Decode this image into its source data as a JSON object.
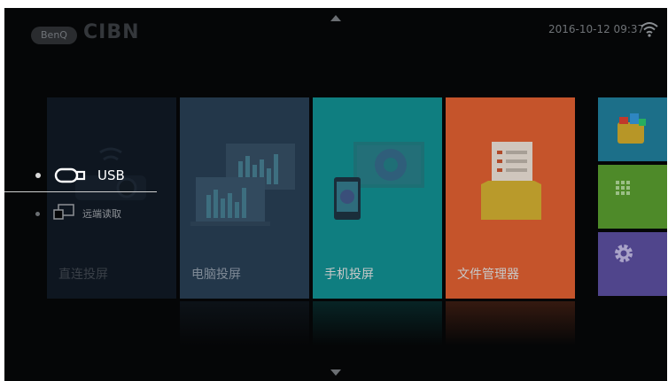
{
  "header": {
    "brand_logo": "BenQ",
    "partner_logo": "CIBN",
    "datetime": "2016-10-12 09:37",
    "wifi_icon": "wifi-icon",
    "nav_up_icon": "arrow-up-icon",
    "nav_down_icon": "arrow-down-icon"
  },
  "tiles": [
    {
      "label": "直连投屏",
      "color": "#0e1620"
    },
    {
      "label": "电脑投屏",
      "color": "#23374a"
    },
    {
      "label": "手机投屏",
      "color": "#0f7e80"
    },
    {
      "label": "文件管理器",
      "color": "#c5542b"
    }
  ],
  "side_tiles": [
    {
      "icon": "app-store-icon",
      "color": "#1c6f89"
    },
    {
      "icon": "apps-grid-icon",
      "color": "#4e8a29"
    },
    {
      "icon": "gear-icon",
      "color": "#50458c"
    }
  ],
  "source_menu": {
    "items": [
      {
        "label": "USB",
        "icon": "usb-drive-icon",
        "selected": true
      },
      {
        "label": "远端读取",
        "icon": "remote-screen-icon",
        "selected": false
      }
    ]
  }
}
